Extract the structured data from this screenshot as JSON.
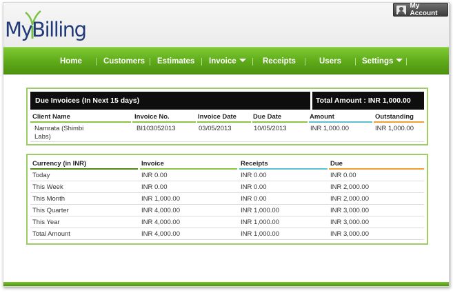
{
  "brand": {
    "logo_text": "MyBilling"
  },
  "header": {
    "account_label": "My Account"
  },
  "nav": {
    "items": [
      {
        "label": "Home",
        "has_dropdown": false
      },
      {
        "label": "Customers",
        "has_dropdown": false
      },
      {
        "label": "Estimates",
        "has_dropdown": false
      },
      {
        "label": "Invoice",
        "has_dropdown": true
      },
      {
        "label": "Receipts",
        "has_dropdown": false
      },
      {
        "label": "Users",
        "has_dropdown": false
      },
      {
        "label": "Settings",
        "has_dropdown": true
      }
    ]
  },
  "due_invoices": {
    "title": "Due Invoices (In Next 15 days)",
    "total_label": "Total Amount : INR 1,000.00",
    "columns": [
      "Client Name",
      "Invoice No.",
      "Invoice Date",
      "Due Date",
      "Amount",
      "Outstanding"
    ],
    "rows": [
      {
        "client": "Namrata (Shimbi Labs)",
        "invoice_no": "BI103052013",
        "invoice_date": "03/05/2013",
        "due_date": "10/05/2013",
        "amount": "INR 1,000.00",
        "outstanding": "INR 1,000.00"
      }
    ]
  },
  "summary": {
    "columns": [
      "Currency (in INR)",
      "Invoice",
      "Receipts",
      "Due"
    ],
    "rows": [
      {
        "period": "Today",
        "invoice": "INR 0.00",
        "receipts": "INR 0.00",
        "due": "INR 0.00"
      },
      {
        "period": "This Week",
        "invoice": "INR 0.00",
        "receipts": "INR 0.00",
        "due": "INR 2,000.00"
      },
      {
        "period": "This Month",
        "invoice": "INR 1,000.00",
        "receipts": "INR 0.00",
        "due": "INR 2,000.00"
      },
      {
        "period": "This Quarter",
        "invoice": "INR 4,000.00",
        "receipts": "INR 1,000.00",
        "due": "INR 3,000.00"
      },
      {
        "period": "This Year",
        "invoice": "INR 4,000.00",
        "receipts": "INR 1,000.00",
        "due": "INR 3,000.00"
      },
      {
        "period": "Total Amount",
        "invoice": "INR 4,000.00",
        "receipts": "INR 1,000.00",
        "due": "INR 3,000.00"
      }
    ]
  },
  "colors": {
    "nav_green": "#5ea919",
    "panel_border": "#9ccc64",
    "accent_green": "#8ac640",
    "accent_teal": "#5bc0d0",
    "accent_orange": "#f0a030",
    "logo_blue": "#213a7a"
  }
}
